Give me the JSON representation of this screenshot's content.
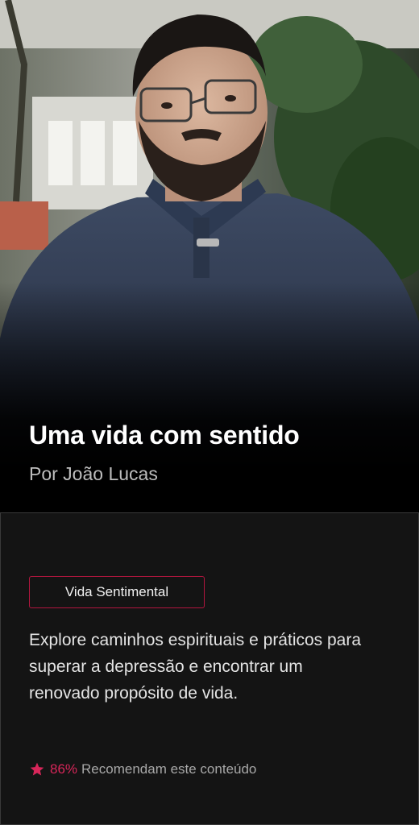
{
  "hero": {
    "title": "Uma vida com sentido",
    "author": "Por João Lucas"
  },
  "details": {
    "category": "Vida Sentimental",
    "description": "Explore caminhos espirituais e práticos para superar a depressão e encontrar um renovado propósito de vida.",
    "rating": {
      "percent": "86%",
      "label": "Recomendam este conteúdo",
      "icon": "star-icon"
    }
  },
  "colors": {
    "accent": "#d8265a",
    "tag_border": "#b3163f",
    "background": "#141414"
  }
}
